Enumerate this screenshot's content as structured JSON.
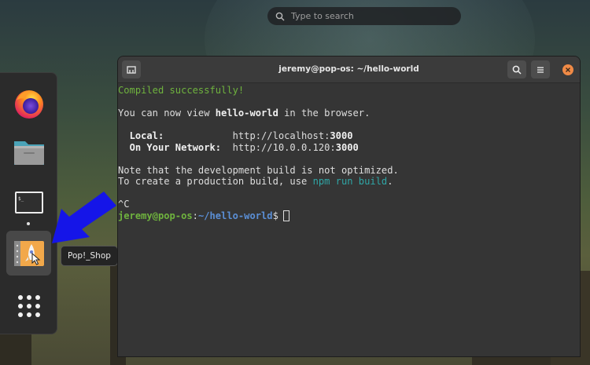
{
  "desktop": {
    "search": {
      "placeholder": "Type to search"
    }
  },
  "dock": {
    "items": [
      {
        "name": "firefox-icon"
      },
      {
        "name": "files-icon"
      },
      {
        "name": "terminal-icon",
        "running": true
      },
      {
        "name": "pop-shop-icon",
        "active": true
      }
    ],
    "tooltip": "Pop!_Shop"
  },
  "terminal": {
    "title": "jeremy@pop-os: ~/hello-world",
    "lines": {
      "compiled": "Compiled successfully!",
      "view_pre": "You can now view ",
      "view_app": "hello-world",
      "view_post": " in the browser.",
      "local_label": "Local:",
      "local_url_pre": "http://localhost:",
      "local_port": "3000",
      "network_label": "On Your Network:",
      "network_url_pre": "http://10.0.0.120:",
      "network_port": "3000",
      "note1": "Note that the development build is not optimized.",
      "note2_pre": "To create a production build, use ",
      "note2_cmd": "npm run build",
      "note2_post": ".",
      "interrupt": "^C",
      "prompt_user": "jeremy@pop-os",
      "prompt_sep": ":",
      "prompt_path": "~/hello-world",
      "prompt_symbol": "$"
    }
  },
  "colors": {
    "accent_orange": "#f08a46",
    "arrow_blue": "#1515e8",
    "terminal_green": "#6fb33e",
    "terminal_cyan": "#2fa6a6",
    "path_blue": "#5b8fd6"
  }
}
